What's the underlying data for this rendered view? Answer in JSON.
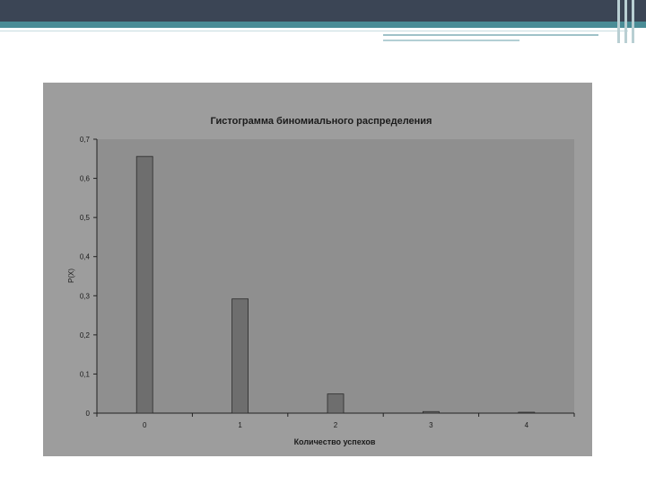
{
  "colors": {
    "header_dark": "#3b4555",
    "header_teal": "#4a8c96",
    "photo_bg": "#9d9d9d",
    "plot_bg": "#8f8f8f",
    "bar_fill": "#6e6e6e",
    "text": "#1c1c1c"
  },
  "chart_data": {
    "type": "bar",
    "title": "Гистограмма биномиального распределения",
    "xlabel": "Количество успехов",
    "ylabel": "P(X)",
    "categories": [
      "0",
      "1",
      "2",
      "3",
      "4"
    ],
    "values": [
      0.656,
      0.292,
      0.049,
      0.004,
      0.0001
    ],
    "ylim": [
      0,
      0.7
    ],
    "yticks": [
      "0",
      "0,1",
      "0,2",
      "0,3",
      "0,4",
      "0,5",
      "0,6",
      "0,7"
    ],
    "grid": false,
    "legend": "none"
  }
}
